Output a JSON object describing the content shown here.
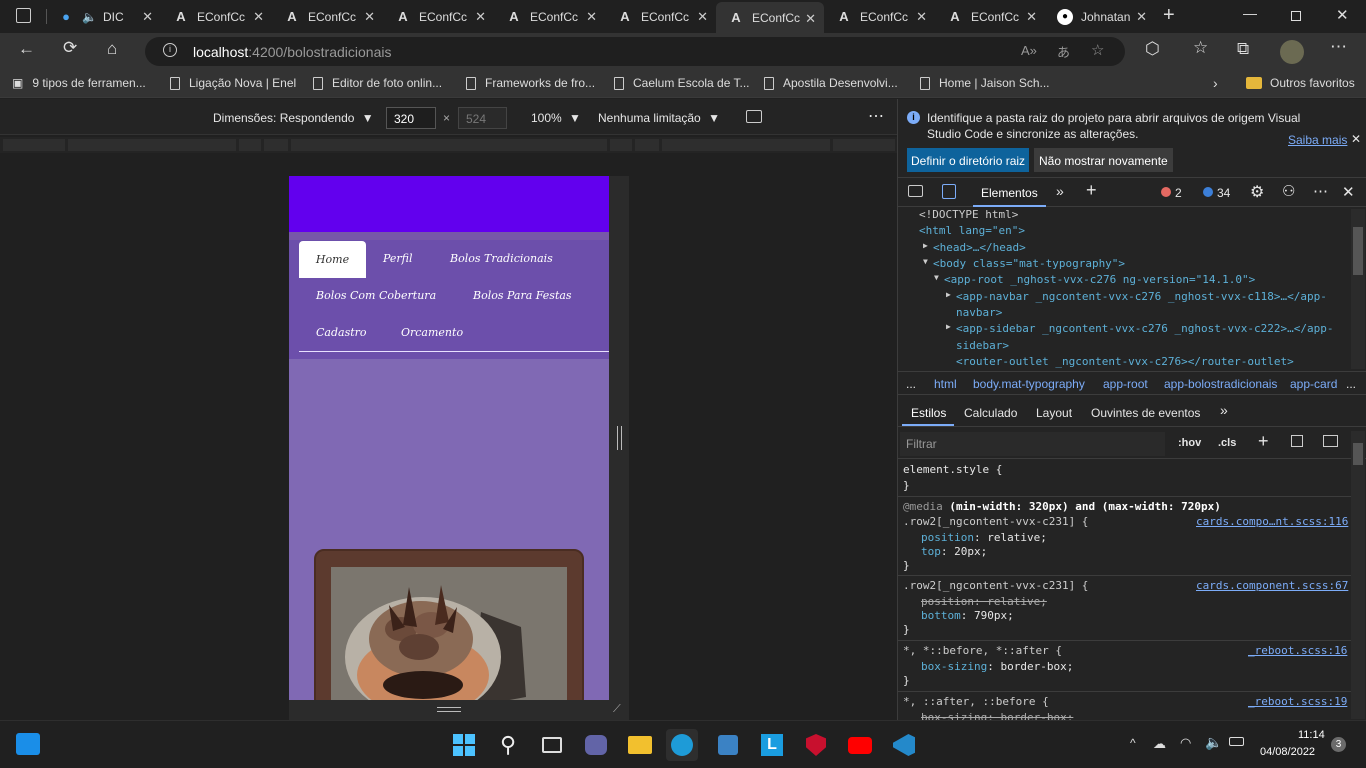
{
  "tabs": [
    {
      "title": "DIC",
      "active": false
    },
    {
      "title": "EConfCc",
      "active": false
    },
    {
      "title": "EConfCc",
      "active": false
    },
    {
      "title": "EConfCc",
      "active": false
    },
    {
      "title": "EConfCc",
      "active": false
    },
    {
      "title": "EConfCc",
      "active": false
    },
    {
      "title": "EConfCc",
      "active": true
    },
    {
      "title": "EConfCc",
      "active": false
    },
    {
      "title": "EConfCc",
      "active": false
    },
    {
      "title": "Johnatan",
      "active": false
    }
  ],
  "address": {
    "host": "localhost",
    "path": ":4200/bolostradicionais"
  },
  "bookmarks": [
    "9 tipos de ferramen...",
    "Ligação Nova | Enel",
    "Editor de foto onlin...",
    "Frameworks de fro...",
    "Caelum Escola de T...",
    "Apostila Desenvolvi...",
    "Home | Jaison Sch...",
    "Outros favoritos"
  ],
  "device_toolbar": {
    "dimensions": "Dimensões: Respondendo",
    "width": "320",
    "height_placeholder": "524",
    "times": "×",
    "zoom": "100%",
    "throttle": "Nenhuma limitação"
  },
  "page_nav": {
    "items": [
      "Home",
      "Perfil",
      "Bolos Tradicionais",
      "Bolos Com Cobertura",
      "Bolos Para Festas",
      "Cadastro",
      "Orcamento"
    ]
  },
  "devtools": {
    "infobar": {
      "message": "Identifique a pasta raiz do projeto para abrir arquivos de origem Visual Studio Code e sincronize as alterações.",
      "learn_more": "Saiba mais",
      "primary_button": "Definir o diretório raiz",
      "secondary_button": "Não mostrar novamente"
    },
    "tabs": {
      "elements": "Elementos",
      "errors": "2",
      "messages": "34"
    },
    "dom": [
      "<!DOCTYPE html>",
      "<html lang=\"en\">",
      "<head>…</head>",
      "<body class=\"mat-typography\">",
      "<app-root _nghost-vvx-c276 ng-version=\"14.1.0\">",
      "<app-navbar _ngcontent-vvx-c276 _nghost-vvx-c118>…</app-",
      "navbar>",
      "<app-sidebar _ngcontent-vvx-c276 _nghost-vvx-c222>…</app-",
      "sidebar>",
      "<router-outlet _ngcontent-vvx-c276></router-outlet>"
    ],
    "breadcrumbs": [
      "...",
      "html",
      "body.mat-typography",
      "app-root",
      "app-bolostradicionais",
      "app-card",
      "..."
    ],
    "style_tabs": [
      "Estilos",
      "Calculado",
      "Layout",
      "Ouvintes de eventos"
    ],
    "filter_placeholder": "Filtrar",
    "hov": ":hov",
    "cls": ".cls",
    "styles": {
      "element_style": "element.style {",
      "close": "}",
      "media": "@media",
      "media_query": "(min-width: 320px) and (max-width: 720px)",
      "rule1_selector": ".row2[_ngcontent-vvx-c231] {",
      "rule1_source": "cards.compo…nt.scss:116",
      "rule1_prop1": "position",
      "rule1_val1": "relative;",
      "rule1_prop2": "top",
      "rule1_val2": "20px;",
      "rule2_selector": ".row2[_ngcontent-vvx-c231] {",
      "rule2_source": "cards.component.scss:67",
      "rule2_prop1": "position: relative;",
      "rule2_prop2": "bottom",
      "rule2_val2": "790px;",
      "rule3_selector": "*, *::before, *::after {",
      "rule3_source": "_reboot.scss:16",
      "rule3_prop1": "box-sizing",
      "rule3_val1": "border-box;",
      "rule4_selector": "*, ::after, ::before {",
      "rule4_source": "_reboot.scss:19",
      "rule4_prop1": "box-sizing: border-box;"
    }
  },
  "taskbar": {
    "time": "11:14",
    "date": "04/08/2022",
    "notifications": "3"
  },
  "colors": {
    "page_header": "#6200ee",
    "page_bg": "#8069b4",
    "nav_bg": "#6c4fab",
    "devtools_blue": "#0e639c"
  }
}
